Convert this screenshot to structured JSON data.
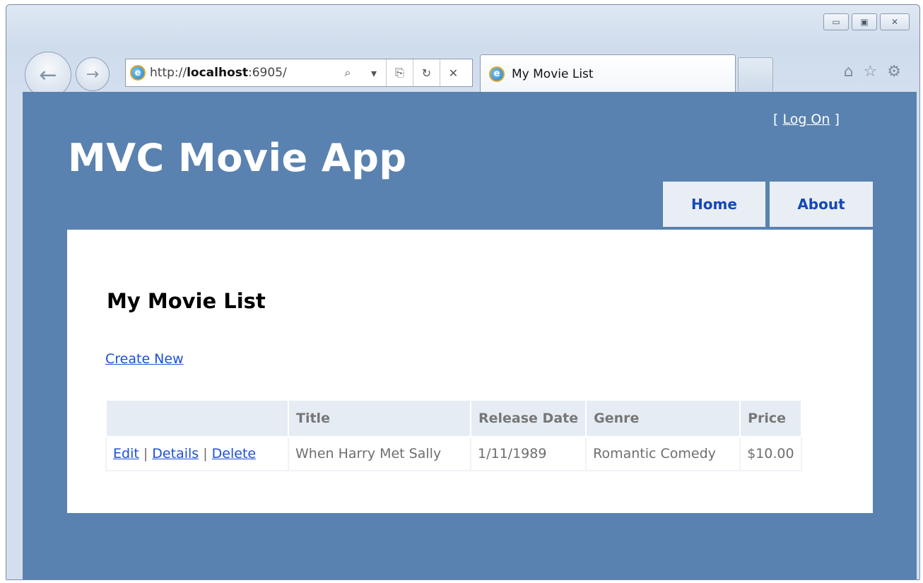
{
  "browser": {
    "url_prefix": "http://",
    "url_host": "localhost",
    "url_rest": ":6905/",
    "tab_title": "My Movie List",
    "search_icon": "⌕",
    "dropdown_icon": "▾",
    "compat_icon": "⎘",
    "refresh_icon": "↻",
    "stop_icon": "✕",
    "back_icon": "←",
    "forward_icon": "→",
    "home_icon": "⌂",
    "favorites_icon": "☆",
    "tools_icon": "⚙",
    "minimize_icon": "▭",
    "maximize_icon": "▣",
    "close_icon": "✕"
  },
  "header": {
    "logon_open": "[ ",
    "logon_label": "Log On",
    "logon_close": " ]",
    "app_title": "MVC Movie App",
    "menu": [
      {
        "label": "Home"
      },
      {
        "label": "About"
      }
    ]
  },
  "main": {
    "page_title": "My Movie List",
    "create_new_label": "Create New",
    "table": {
      "columns": [
        "",
        "Title",
        "Release Date",
        "Genre",
        "Price"
      ],
      "rows": [
        {
          "actions": {
            "edit": "Edit",
            "separator": "|",
            "details": "Details",
            "delete": "Delete"
          },
          "title": "When Harry Met Sally",
          "release_date": "1/11/1989",
          "genre": "Romantic Comedy",
          "price": "$10.00"
        }
      ]
    }
  },
  "colors": {
    "page_background": "#5a82b0",
    "link": "#1d4fd6",
    "menu_text": "#1448b8"
  }
}
